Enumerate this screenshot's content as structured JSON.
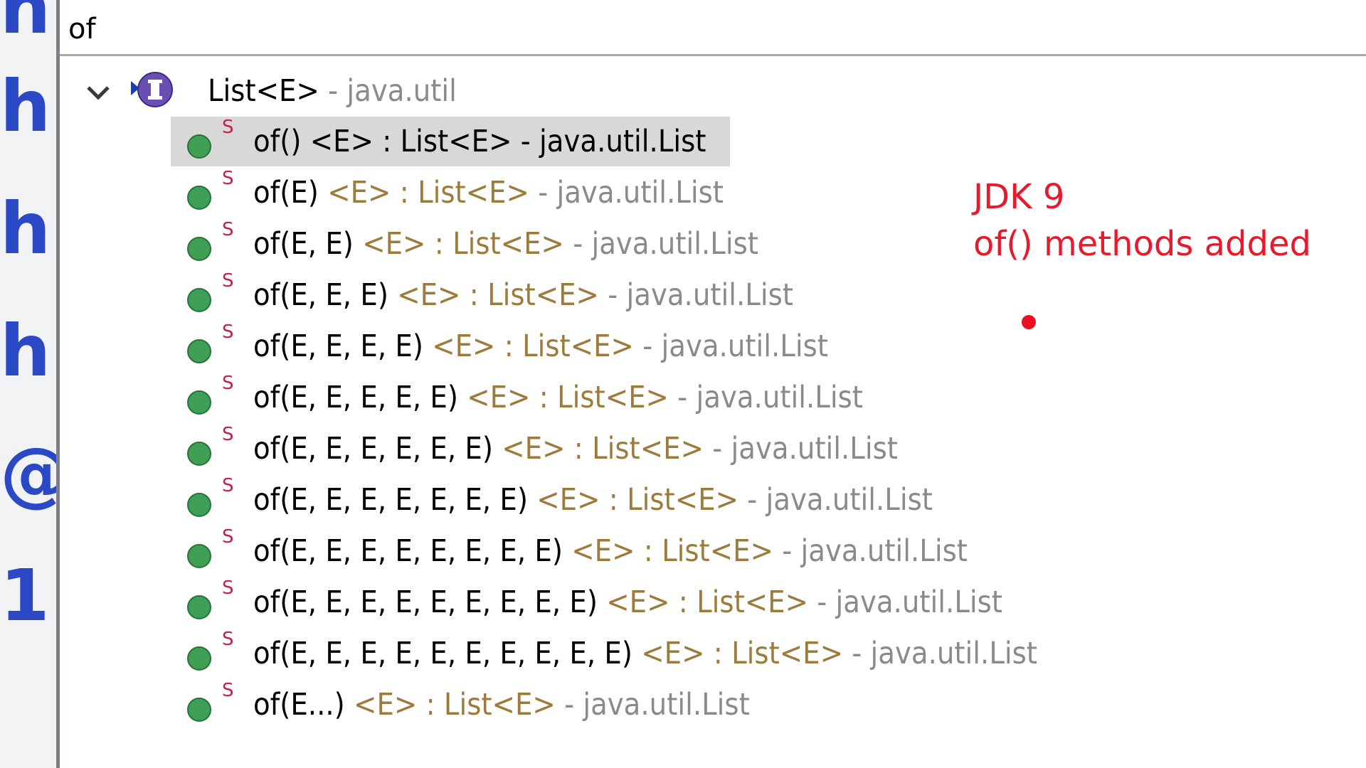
{
  "sidebar": {
    "glyphs": [
      "h",
      "h",
      "h",
      "@",
      "1"
    ]
  },
  "search": {
    "value": "of"
  },
  "tree": {
    "type_name": "List<E>",
    "type_package": " - java.util",
    "methods": [
      {
        "signature": "of()",
        "return": " <E> : List<E>",
        "package": " - java.util.List",
        "selected": true
      },
      {
        "signature": "of(E)",
        "return": " <E> : List<E>",
        "package": " - java.util.List"
      },
      {
        "signature": "of(E, E)",
        "return": " <E> : List<E>",
        "package": " - java.util.List"
      },
      {
        "signature": "of(E, E, E)",
        "return": " <E> : List<E>",
        "package": " - java.util.List"
      },
      {
        "signature": "of(E, E, E, E)",
        "return": " <E> : List<E>",
        "package": " - java.util.List"
      },
      {
        "signature": "of(E, E, E, E, E)",
        "return": " <E> : List<E>",
        "package": " - java.util.List"
      },
      {
        "signature": "of(E, E, E, E, E, E)",
        "return": " <E> : List<E>",
        "package": " - java.util.List"
      },
      {
        "signature": "of(E, E, E, E, E, E, E)",
        "return": " <E> : List<E>",
        "package": " - java.util.List"
      },
      {
        "signature": "of(E, E, E, E, E, E, E, E)",
        "return": " <E> : List<E>",
        "package": " - java.util.List"
      },
      {
        "signature": "of(E, E, E, E, E, E, E, E, E)",
        "return": " <E> : List<E>",
        "package": " - java.util.List"
      },
      {
        "signature": "of(E, E, E, E, E, E, E, E, E, E)",
        "return": " <E> : List<E>",
        "package": " - java.util.List"
      },
      {
        "signature": "of(E...)",
        "return": " <E> : List<E>",
        "package": " - java.util.List"
      }
    ],
    "static_marker": "S",
    "icons": {
      "expand": "chevron-down-icon",
      "type": "interface-icon",
      "method": "public-method-icon"
    }
  },
  "annotation": {
    "line1": "JDK 9",
    "line2": "of() methods added"
  },
  "colors": {
    "annotation": "#e8192c",
    "method_icon": "#3f9f55",
    "interface_icon": "#6a4fb3",
    "sidebar_glyph": "#2b49c7",
    "return_type": "#9c7b3b",
    "package": "#8a8a8a",
    "static_mark": "#c0244a",
    "selection": "#d8d8d8"
  }
}
